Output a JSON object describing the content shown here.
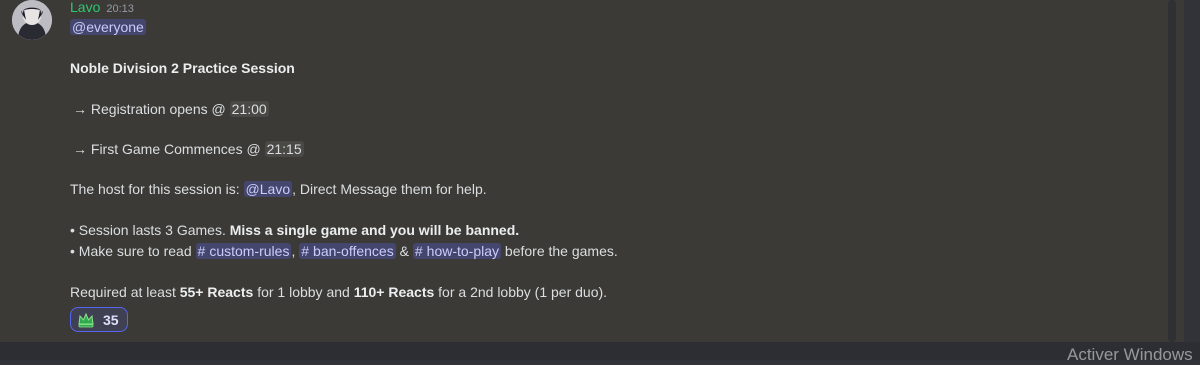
{
  "message": {
    "author": "Lavo",
    "timestamp": "20:13",
    "author_color": "#2dc770",
    "avatar_icon": "user-avatar",
    "everyone_mention": "@everyone",
    "title": "Noble Division 2 Practice Session",
    "registration": {
      "arrow": "→",
      "text": "Registration opens @",
      "time": "21:00"
    },
    "first_game": {
      "arrow": "→",
      "text": "First Game Commences @",
      "time": "21:15"
    },
    "host": {
      "prefix": "The host for this session is:",
      "mention": "@Lavo",
      "suffix": ", Direct Message them for help."
    },
    "rule1": {
      "prefix": "• Session lasts 3 Games.",
      "bold": "Miss a single game and you will be banned."
    },
    "rule2": {
      "prefix": "• Make sure to read",
      "channel1": "custom-rules",
      "sep1": ",",
      "channel2": "ban-offences",
      "sep2": "&",
      "channel3": "how-to-play",
      "suffix": "before the games.",
      "channel_icon": "#"
    },
    "requirement": {
      "t1": "Required at least",
      "b1": "55+ Reacts",
      "t2": "for 1 lobby and",
      "b2": "110+ Reacts",
      "t3": "for a 2nd lobby (1 per duo)."
    },
    "reaction": {
      "icon": "crown-icon",
      "count": "35"
    }
  },
  "os_watermark": "Activer Windows",
  "colors": {
    "message_bg": "#3b3a36",
    "mention_text": "#c9cdfb",
    "reaction_border": "#5865f2"
  }
}
